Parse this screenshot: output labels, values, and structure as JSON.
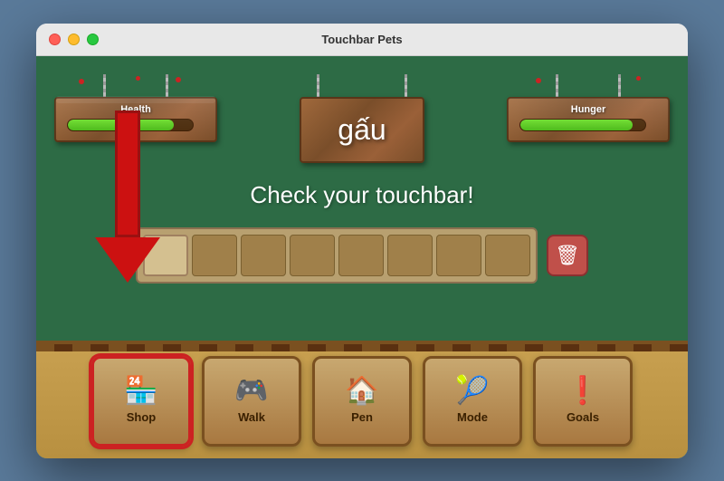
{
  "window": {
    "title": "Touchbar Pets"
  },
  "titlebar": {
    "traffic_lights": {
      "close": "close",
      "minimize": "minimize",
      "maximize": "maximize"
    }
  },
  "signs": {
    "health_label": "Health",
    "health_percent": 85,
    "hunger_label": "Hunger",
    "hunger_percent": 90,
    "pet_name": "gấu"
  },
  "main": {
    "check_text": "Check your touchbar!"
  },
  "buttons": [
    {
      "id": "shop",
      "label": "Shop",
      "icon": "🏪",
      "selected": true
    },
    {
      "id": "walk",
      "label": "Walk",
      "icon": "🎮",
      "selected": false
    },
    {
      "id": "pen",
      "label": "Pen",
      "icon": "🏠",
      "selected": false
    },
    {
      "id": "mode",
      "label": "Mode",
      "icon": "🎾",
      "selected": false
    },
    {
      "id": "goals",
      "label": "Goals",
      "icon": "❗",
      "selected": false
    }
  ],
  "touchbar": {
    "trash_icon": "🗑"
  },
  "colors": {
    "bg": "#2d6b45",
    "sign_bg": "#8B5E3C",
    "health_bar": "#4ab818",
    "button_bg": "#c8a870",
    "button_border": "#7a5020",
    "selected_border": "#cc2222",
    "bottom_bg": "#c8a050"
  }
}
